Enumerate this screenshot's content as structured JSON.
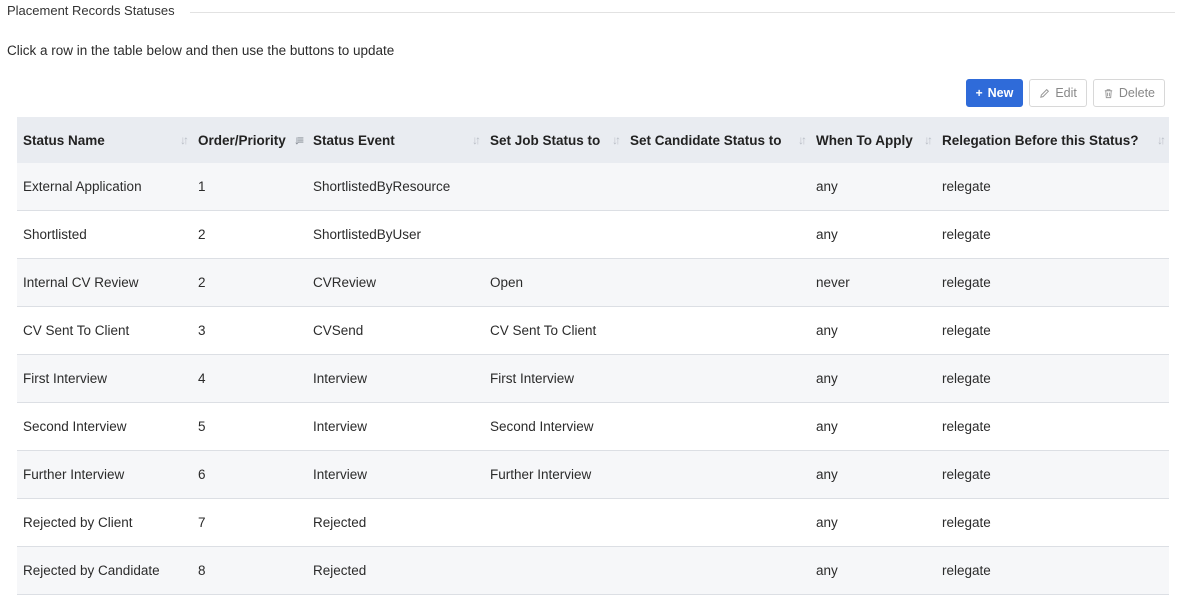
{
  "section": {
    "legend": "Placement Records Statuses"
  },
  "instructions": "Click a row in the table below and then use the buttons to update",
  "toolbar": {
    "new_label": "New",
    "edit_label": "Edit",
    "delete_label": "Delete"
  },
  "colors": {
    "primary": "#2f6bd9",
    "header_bg": "#e9ecf1",
    "row_alt": "#f6f7f9"
  },
  "table": {
    "columns": [
      "Status Name",
      "Order/Priority",
      "Status Event",
      "Set Job Status to",
      "Set Candidate Status to",
      "When To Apply",
      "Relegation Before this Status?"
    ],
    "sorted_column": "Order/Priority",
    "sort_direction": "ascending",
    "rows": [
      [
        "External Application",
        "1",
        "ShortlistedByResource",
        "",
        "",
        "any",
        "relegate"
      ],
      [
        "Shortlisted",
        "2",
        "ShortlistedByUser",
        "",
        "",
        "any",
        "relegate"
      ],
      [
        "Internal CV Review",
        "2",
        "CVReview",
        "Open",
        "",
        "never",
        "relegate"
      ],
      [
        "CV Sent To Client",
        "3",
        "CVSend",
        "CV Sent To Client",
        "",
        "any",
        "relegate"
      ],
      [
        "First Interview",
        "4",
        "Interview",
        "First Interview",
        "",
        "any",
        "relegate"
      ],
      [
        "Second Interview",
        "5",
        "Interview",
        "Second Interview",
        "",
        "any",
        "relegate"
      ],
      [
        "Further Interview",
        "6",
        "Interview",
        "Further Interview",
        "",
        "any",
        "relegate"
      ],
      [
        "Rejected by Client",
        "7",
        "Rejected",
        "",
        "",
        "any",
        "relegate"
      ],
      [
        "Rejected by Candidate",
        "8",
        "Rejected",
        "",
        "",
        "any",
        "relegate"
      ]
    ]
  }
}
